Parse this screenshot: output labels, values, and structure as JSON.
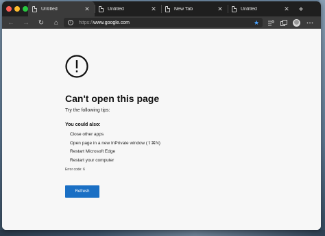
{
  "browser": {
    "tabs": [
      {
        "title": "Untitled",
        "active": true,
        "icon": "page-icon",
        "close": "✕"
      },
      {
        "title": "Untitled",
        "active": false,
        "icon": "page-icon",
        "close": "✕"
      },
      {
        "title": "New Tab",
        "active": false,
        "icon": "page-icon",
        "close": "✕"
      },
      {
        "title": "Untitled",
        "active": false,
        "icon": "page-icon",
        "close": "✕"
      }
    ],
    "new_tab_icon": "+",
    "nav": {
      "back_icon": "←",
      "forward_icon": "→",
      "refresh_icon": "↻",
      "home_icon": "⌂"
    },
    "address": {
      "info_icon": "i",
      "protocol": "https://",
      "host": "www.google.com"
    },
    "favorite_icon": "★",
    "colors": {
      "accent_star": "#4aa3ff",
      "tabbar": "#1f1f1f",
      "toolbar": "#3b3b3b"
    }
  },
  "page": {
    "error_icon": "exclamation-circle-icon",
    "heading": "Can't open this page",
    "tips_intro": "Try the following tips:",
    "could_also": "You could also:",
    "tips": [
      "Close other apps",
      "Open page in a new InPrivate window (⇧⌘N)",
      "Restart Microsoft Edge",
      "Restart your computer"
    ],
    "error_code": "Error code: 6",
    "refresh_label": "Refresh",
    "colors": {
      "button": "#1a6fc4"
    }
  }
}
